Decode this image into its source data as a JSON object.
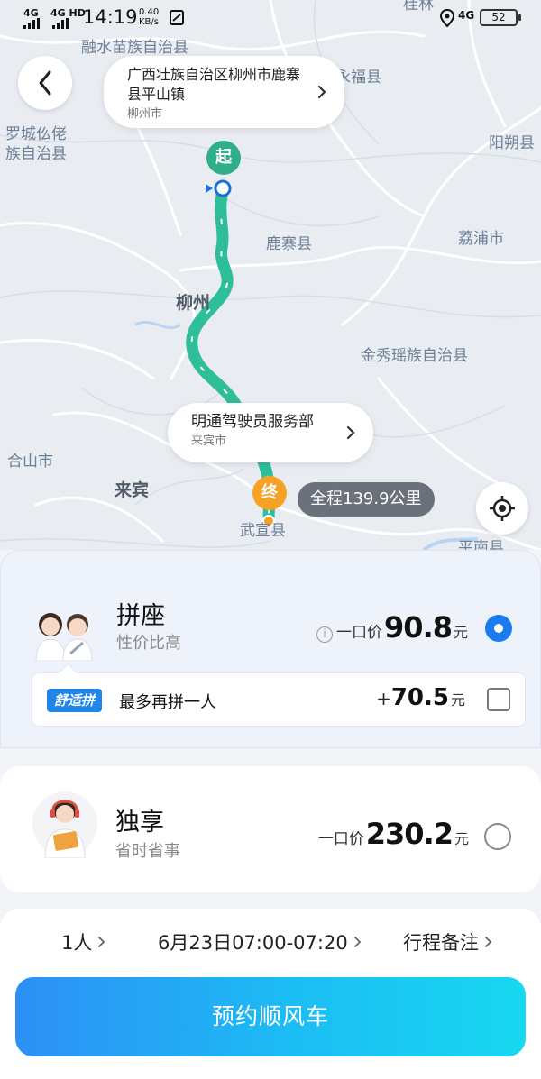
{
  "status_bar": {
    "network1": "4G",
    "network2": "4G HD",
    "time": "14:19",
    "speed": "0.40",
    "speed_unit": "KB/s",
    "network3": "4G",
    "battery": "52"
  },
  "map": {
    "labels": {
      "guilin": "桂林",
      "rongshui": "融水苗族自治县",
      "yongfu": "永福县",
      "luocheng": "罗城仫佬族自治县",
      "yangshuo": "阳朔县",
      "luzhai": "鹿寨县",
      "lipu": "荔浦市",
      "liuzhou": "柳州",
      "jinxiu": "金秀瑶族自治县",
      "heshan": "合山市",
      "laibin": "来宾",
      "wuxuan": "武宣县",
      "pingnan": "平南县"
    },
    "origin": {
      "title": "广西壮族自治区柳州市鹿寨县平山镇",
      "city": "柳州市",
      "pin": "起"
    },
    "destination": {
      "title": "明通驾驶员服务部",
      "city": "来宾市",
      "pin": "终"
    },
    "distance": "全程139.9公里",
    "route_color": "#2fbe9a"
  },
  "options": {
    "carpool": {
      "title": "拼座",
      "subtitle": "性价比高",
      "price_label": "一口价",
      "price": "90.8",
      "unit": "元",
      "selected": true,
      "comfort": {
        "tag": "舒适拼",
        "text": "最多再拼一人",
        "plus": "+",
        "price": "70.5",
        "unit": "元",
        "checked": false
      }
    },
    "solo": {
      "title": "独享",
      "subtitle": "省时省事",
      "price_label": "一口价",
      "price": "230.2",
      "unit": "元",
      "selected": false
    }
  },
  "booking": {
    "passengers": "1人",
    "time": "6月23日07:00-07:20",
    "notes": "行程备注",
    "button": "预约顺风车"
  },
  "colors": {
    "accent": "#1a7cf0",
    "button_start": "#2d8ff5",
    "button_end": "#18d8f0",
    "start_pin": "#2fae8a",
    "end_pin": "#f7a224"
  }
}
